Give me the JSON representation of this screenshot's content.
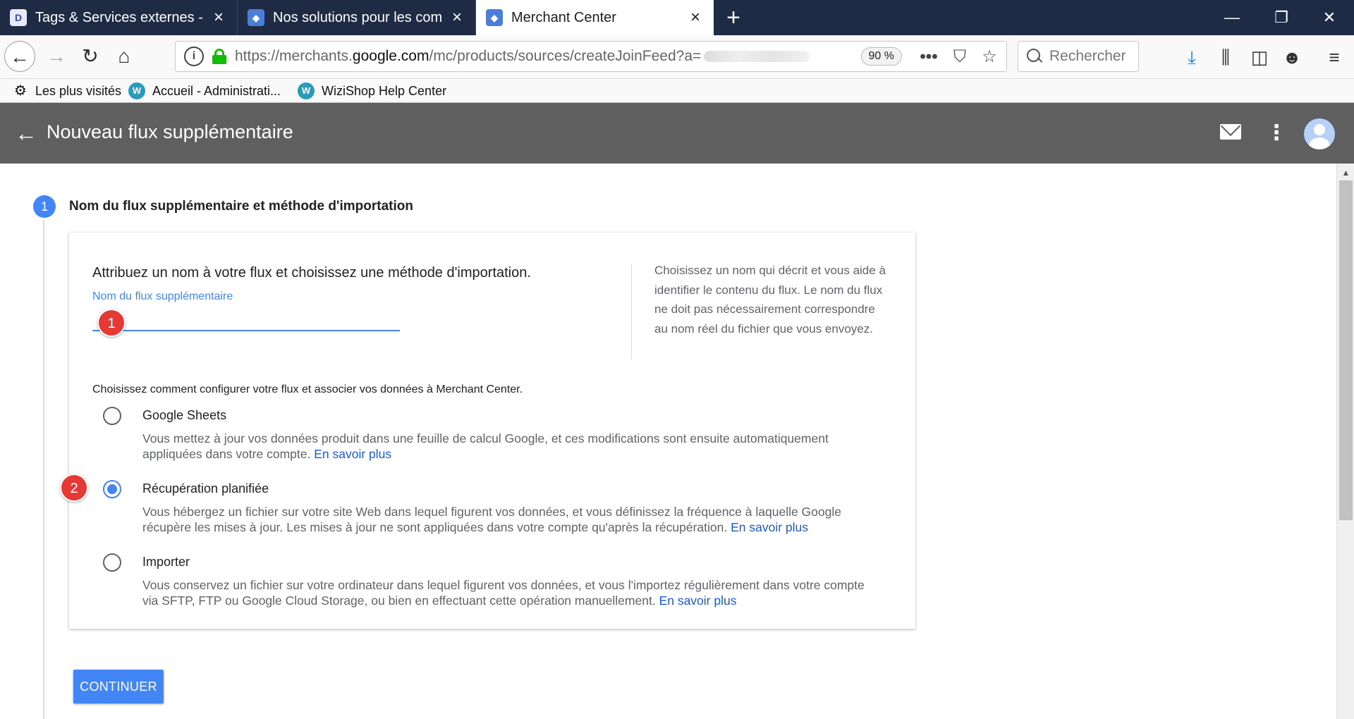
{
  "browser": {
    "tabs": [
      {
        "label": "Tags & Services externes - Préfé",
        "favicon": "D",
        "active": false
      },
      {
        "label": "Nos solutions pour les commerç",
        "favicon": "merchant-tag",
        "active": false
      },
      {
        "label": "Merchant Center",
        "favicon": "merchant-tag",
        "active": true
      }
    ],
    "new_tab_symbol": "+",
    "window_controls": {
      "minimize": "—",
      "restore": "❐",
      "close": "✕"
    },
    "url_prefix": "https://merchants.",
    "url_domain": "google.com",
    "url_path": "/mc/products/sources/createJoinFeed?a=",
    "zoom": "90 %",
    "search_placeholder": "Rechercher",
    "bookmarks": [
      {
        "label": "Les plus visités",
        "icon": "gear-icon"
      },
      {
        "label": "Accueil - Administrati...",
        "icon": "W"
      },
      {
        "label": "WiziShop Help Center",
        "icon": "W"
      }
    ]
  },
  "header": {
    "title": "Nouveau flux supplémentaire"
  },
  "step": {
    "number": "1",
    "title": "Nom du flux supplémentaire et méthode d'importation"
  },
  "card": {
    "heading": "Attribuez un nom à votre flux et choisissez une méthode d'importation.",
    "field_label": "Nom du flux supplémentaire",
    "field_value": "",
    "help_text": "Choisissez un nom qui décrit et vous aide à identifier le contenu du flux. Le nom du flux ne doit pas nécessairement correspondre au nom réel du fichier que vous envoyez.",
    "prompt": "Choisissez comment configurer votre flux et associer vos données à Merchant Center.",
    "options": [
      {
        "name": "Google Sheets",
        "selected": false,
        "description": "Vous mettez à jour vos données produit dans une feuille de calcul Google, et ces modifications sont ensuite automatiquement appliquées dans votre compte. ",
        "link": "En savoir plus"
      },
      {
        "name": "Récupération planifiée",
        "selected": true,
        "description": "Vous hébergez un fichier sur votre site Web dans lequel figurent vos données, et vous définissez la fréquence à laquelle Google récupère les mises à jour. Les mises à jour ne sont appliquées dans votre compte qu'après la récupération. ",
        "link": "En savoir plus"
      },
      {
        "name": "Importer",
        "selected": false,
        "description": "Vous conservez un fichier sur votre ordinateur dans lequel figurent vos données, et vous l'importez régulièrement dans votre compte via SFTP, FTP ou Google Cloud Storage, ou bien en effectuant cette opération manuellement. ",
        "link": "En savoir plus"
      }
    ]
  },
  "annotations": [
    {
      "number": "1"
    },
    {
      "number": "2"
    }
  ],
  "actions": {
    "continue_label": "CONTINUER"
  },
  "colors": {
    "accent": "#4285f4",
    "appbar": "#5f5f5f",
    "annotation": "#e53935",
    "secure": "#12bc00"
  }
}
